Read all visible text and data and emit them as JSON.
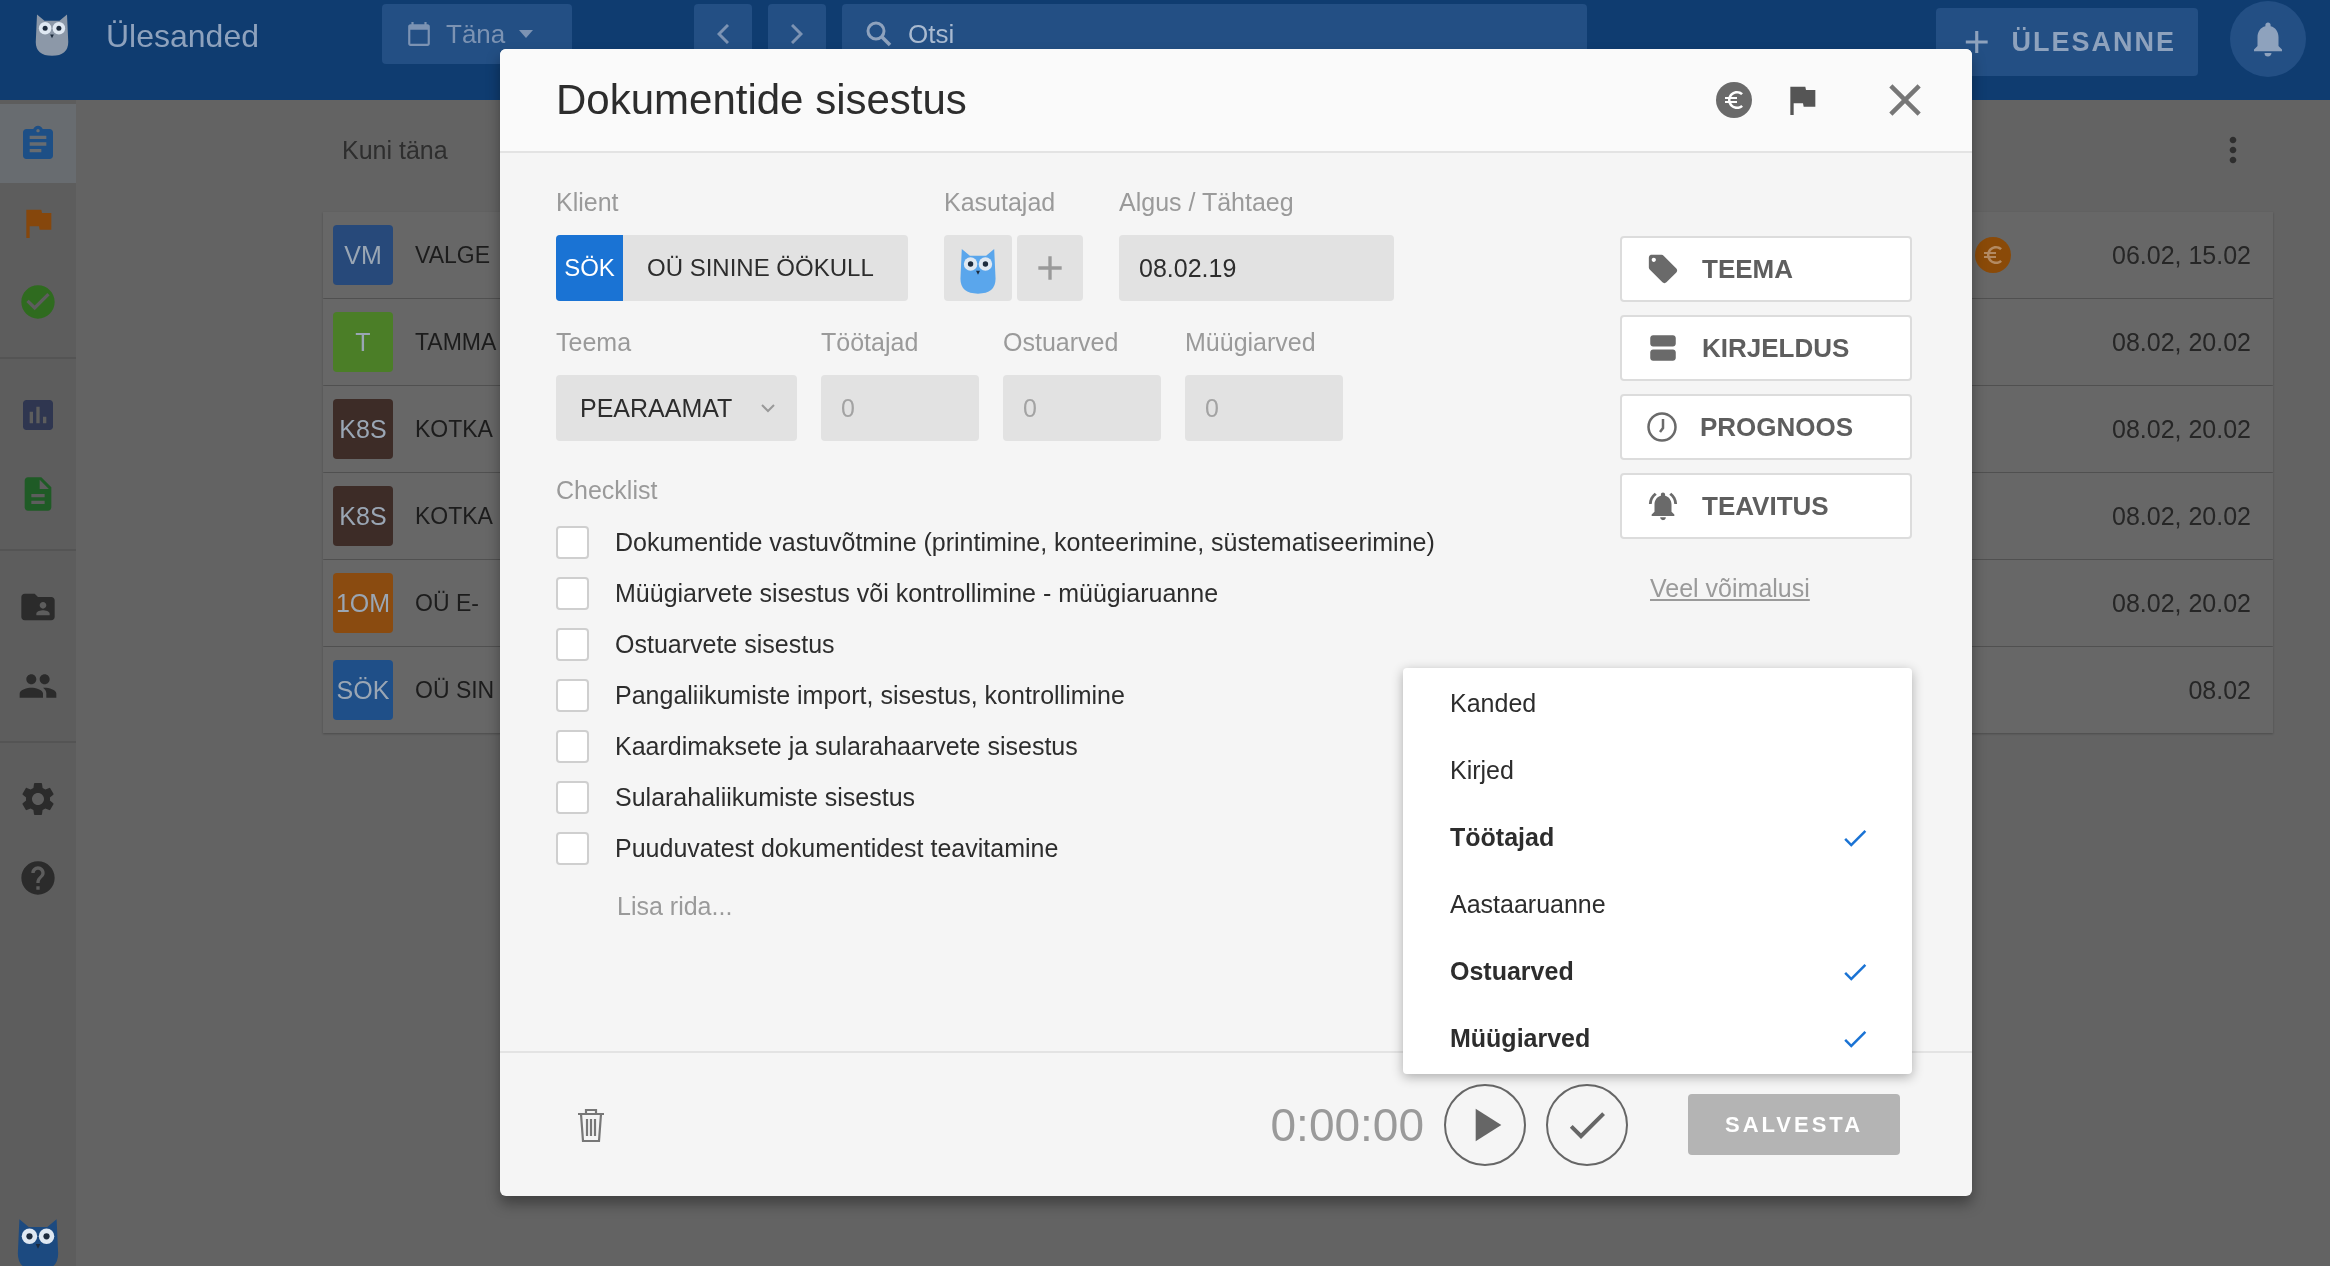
{
  "app_bar": {
    "title": "Ülesanded",
    "date_button": "Täna",
    "search": {
      "placeholder": "Otsi"
    },
    "new_task_button": "ÜLESANNE"
  },
  "sidebar": {
    "items": [
      {
        "kind": "tasks",
        "selected": true
      },
      {
        "kind": "flag",
        "selected": false
      },
      {
        "kind": "done",
        "selected": false
      },
      {
        "kind": "chart",
        "selected": false
      },
      {
        "kind": "document",
        "selected": false
      },
      {
        "kind": "folder",
        "selected": false
      },
      {
        "kind": "people",
        "selected": false
      },
      {
        "kind": "settings",
        "selected": false
      },
      {
        "kind": "help",
        "selected": false
      }
    ]
  },
  "task_list": {
    "heading": "Kuni täna",
    "rows": [
      {
        "badge": "VM",
        "color": "#27497a",
        "name": "VALGE",
        "euro": true,
        "dates": "06.02, 15.02"
      },
      {
        "badge": "T",
        "color": "#4b7e27",
        "name": "TAMMA",
        "euro": false,
        "dates": "08.02, 20.02"
      },
      {
        "badge": "K8S",
        "color": "#3d2c27",
        "name": "KOTKA",
        "euro": false,
        "dates": "08.02, 20.02"
      },
      {
        "badge": "K8S",
        "color": "#3d2c27",
        "name": "KOTKA",
        "euro": false,
        "dates": "08.02, 20.02"
      },
      {
        "badge": "1OM",
        "color": "#8a4b10",
        "name": "OÜ E-",
        "euro": false,
        "dates": "08.02, 20.02"
      },
      {
        "badge": "SÖK",
        "color": "#1f4f88",
        "name": "OÜ SIN",
        "euro": false,
        "dates": "08.02"
      }
    ]
  },
  "dialog": {
    "title": "Dokumentide sisestus",
    "client": {
      "label": "Klient",
      "code": "SÖK",
      "name": "OÜ SININE ÖÖKULL"
    },
    "users": {
      "label": "Kasutajad"
    },
    "dates": {
      "label": "Algus / Tähtaeg",
      "value": "08.02.19"
    },
    "theme": {
      "label": "Teema",
      "value": "PEARAAMAT"
    },
    "counts": [
      {
        "label": "Töötajad",
        "placeholder": "0"
      },
      {
        "label": "Ostuarved",
        "placeholder": "0"
      },
      {
        "label": "Müügiarved",
        "placeholder": "0"
      }
    ],
    "checklist": {
      "label": "Checklist",
      "items": [
        {
          "text": "Dokumentide vastuvõtmine (printimine, konteerimine, süstematiseerimine)",
          "checked": false
        },
        {
          "text": "Müügiarvete sisestus või kontrollimine - müügiaruanne",
          "checked": false
        },
        {
          "text": "Ostuarvete sisestus",
          "checked": false
        },
        {
          "text": "Pangaliikumiste import, sisestus, kontrollimine",
          "checked": false
        },
        {
          "text": "Kaardimaksete ja sularahaarvete sisestus",
          "checked": false
        },
        {
          "text": "Sularahaliikumiste sisestus",
          "checked": false
        },
        {
          "text": "Puuduvatest dokumentidest teavitamine",
          "checked": false
        }
      ],
      "add_row": "Lisa rida..."
    },
    "side_buttons": [
      {
        "kind": "tag",
        "label": "TEEMA"
      },
      {
        "kind": "description",
        "label": "KIRJELDUS"
      },
      {
        "kind": "clock",
        "label": "PROGNOOS"
      },
      {
        "kind": "bell",
        "label": "TEAVITUS"
      }
    ],
    "more_link": "Veel võimalusi",
    "menu": [
      {
        "label": "Kanded",
        "checked": false
      },
      {
        "label": "Kirjed",
        "checked": false
      },
      {
        "label": "Töötajad",
        "checked": true
      },
      {
        "label": "Aastaaruanne",
        "checked": false
      },
      {
        "label": "Ostuarved",
        "checked": true
      },
      {
        "label": "Müügiarved",
        "checked": true
      }
    ],
    "footer": {
      "timer": "0:00:00",
      "save_button": {
        "label": "SALVESTA",
        "disabled": true
      }
    }
  }
}
